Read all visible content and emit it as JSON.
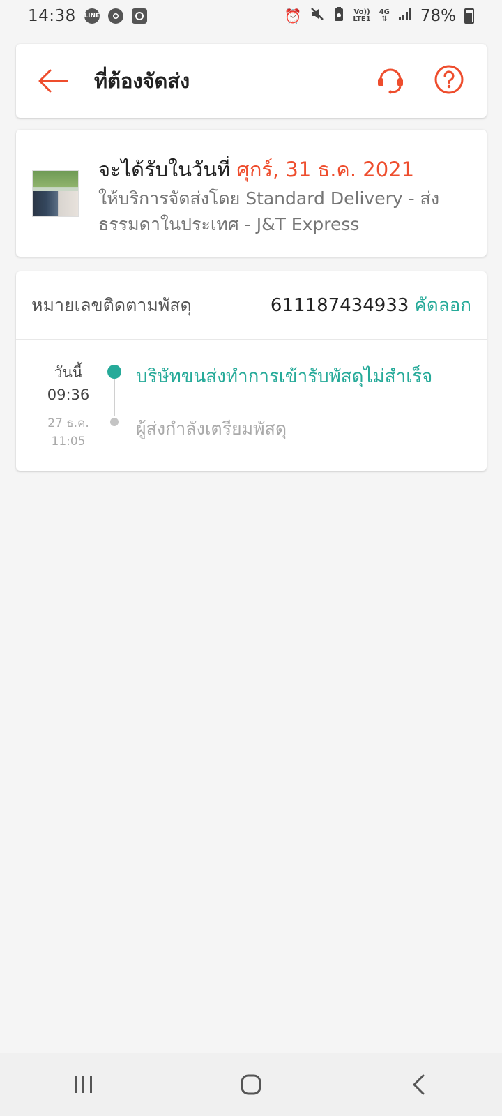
{
  "status_bar": {
    "time": "14:38",
    "battery": "78%",
    "network_top": "Vo))",
    "network_bottom": "LTE1",
    "gen": "4G",
    "left_icons": [
      "line-icon",
      "chrome-icon",
      "screen-record-icon"
    ],
    "right_icons": [
      "alarm-icon",
      "mute-icon",
      "battery-saver-icon",
      "signal-icon",
      "battery-icon"
    ]
  },
  "header": {
    "title": "ที่ต้องจัดส่ง",
    "icons": [
      "back-arrow-icon",
      "headset-icon",
      "help-icon"
    ],
    "accent": "#ee4d2d"
  },
  "delivery": {
    "eta_prefix": "จะได้รับในวันที่ ",
    "eta_date": "ศุกร์, 31 ธ.ค. 2021",
    "service_text": "ให้บริการจัดส่งโดย Standard Delivery - ส่งธรรมดาในประเทศ - J&T Express"
  },
  "tracking": {
    "label": "หมายเลขติดตามพัสดุ",
    "number": "611187434933",
    "copy_label": "คัดลอก",
    "copy_color": "#26aa99"
  },
  "timeline": [
    {
      "date": "วันนี้",
      "time": "09:36",
      "text": "บริษัทขนส่งทำการเข้ารับพัสดุไม่สำเร็จ",
      "active": true
    },
    {
      "date": "27 ธ.ค.",
      "time": "11:05",
      "text": "ผู้ส่งกำลังเตรียมพัสดุ",
      "active": false
    }
  ],
  "nav_bar": {
    "buttons": [
      "recent-apps-icon",
      "home-icon",
      "back-icon"
    ]
  }
}
